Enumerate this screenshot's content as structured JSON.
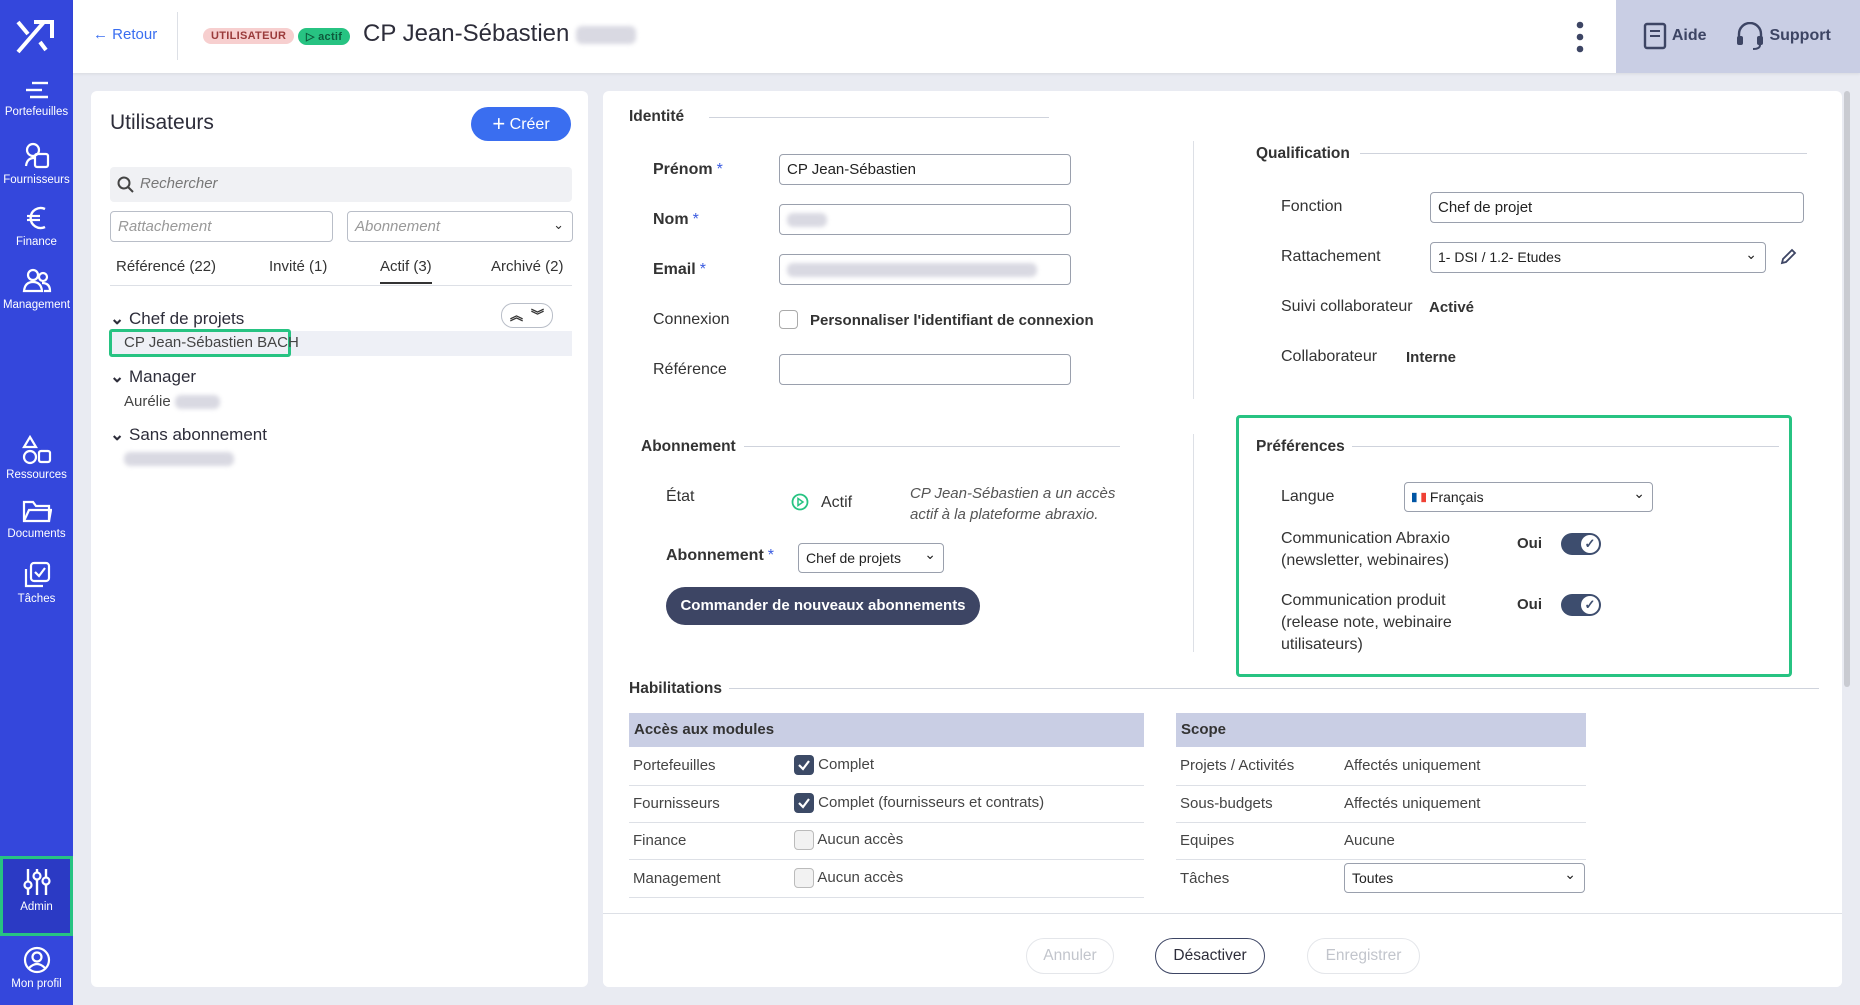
{
  "sidebar": {
    "items": [
      {
        "label": "Portefeuilles",
        "icon": "portfolio-icon"
      },
      {
        "label": "Fournisseurs",
        "icon": "suppliers-icon"
      },
      {
        "label": "Finance",
        "icon": "euro-icon"
      },
      {
        "label": "Management",
        "icon": "people-icon"
      },
      {
        "label": "Ressources",
        "icon": "shapes-icon"
      },
      {
        "label": "Documents",
        "icon": "folder-icon"
      },
      {
        "label": "Tâches",
        "icon": "tasks-icon"
      },
      {
        "label": "Admin",
        "icon": "sliders-icon"
      },
      {
        "label": "Mon profil",
        "icon": "user-circle-icon"
      }
    ]
  },
  "header": {
    "back_label": "Retour",
    "tag_user": "UTILISATEUR",
    "tag_active": "actif",
    "title": "CP Jean-Sébastien",
    "help_label": "Aide",
    "support_label": "Support"
  },
  "users": {
    "title": "Utilisateurs",
    "create_label": "Créer",
    "search_placeholder": "Rechercher",
    "rattachement_placeholder": "Rattachement",
    "abonnement_placeholder": "Abonnement",
    "tabs": [
      "Référencé (22)",
      "Invité (1)",
      "Actif (3)",
      "Archivé (2)"
    ],
    "groups": [
      {
        "name": "Chef de projets",
        "members": [
          "CP Jean-Sébastien BACH"
        ]
      },
      {
        "name": "Manager",
        "members": [
          "Aurélie"
        ]
      },
      {
        "name": "Sans abonnement",
        "members": []
      }
    ]
  },
  "identity": {
    "section": "Identité",
    "prenom_label": "Prénom",
    "prenom_value": "CP Jean-Sébastien",
    "nom_label": "Nom",
    "email_label": "Email",
    "connexion_label": "Connexion",
    "connexion_checkbox": "Personnaliser l'identifiant de connexion",
    "reference_label": "Référence",
    "required_mark": "*"
  },
  "qualification": {
    "section": "Qualification",
    "fonction_label": "Fonction",
    "fonction_value": "Chef de projet",
    "rattachement_label": "Rattachement",
    "rattachement_value": "1- DSI / 1.2- Etudes",
    "suivi_label": "Suivi collaborateur",
    "suivi_value": "Activé",
    "collaborateur_label": "Collaborateur",
    "collaborateur_value": "Interne"
  },
  "abonnement": {
    "section": "Abonnement",
    "etat_label": "État",
    "etat_value": "Actif",
    "note": "CP Jean-Sébastien a un accès actif à la plateforme abraxio.",
    "abonnement_label": "Abonnement",
    "abonnement_value": "Chef de projets",
    "order_button": "Commander de nouveaux abonnements"
  },
  "preferences": {
    "section": "Préférences",
    "langue_label": "Langue",
    "langue_value": "Français",
    "comm_abraxio_label": "Communication Abraxio (newsletter, webinaires)",
    "comm_abraxio_value": "Oui",
    "comm_produit_label": "Communication produit (release note, webinaire utilisateurs)",
    "comm_produit_value": "Oui"
  },
  "habilitations": {
    "section": "Habilitations",
    "modules_header": "Accès aux modules",
    "modules": [
      {
        "name": "Portefeuilles",
        "value": "Complet",
        "checked": true
      },
      {
        "name": "Fournisseurs",
        "value": "Complet (fournisseurs et contrats)",
        "checked": true
      },
      {
        "name": "Finance",
        "value": "Aucun accès",
        "checked": false
      },
      {
        "name": "Management",
        "value": "Aucun accès",
        "checked": false
      }
    ],
    "scope_header": "Scope",
    "scope": [
      {
        "name": "Projets / Activités",
        "value": "Affectés uniquement"
      },
      {
        "name": "Sous-budgets",
        "value": "Affectés uniquement"
      },
      {
        "name": "Equipes",
        "value": "Aucune"
      },
      {
        "name": "Tâches",
        "value": "Toutes"
      }
    ]
  },
  "footer": {
    "cancel_label": "Annuler",
    "deactivate_label": "Désactiver",
    "save_label": "Enregistrer"
  },
  "colors": {
    "sidebar": "#3447dc",
    "accent": "#3a6ef0",
    "highlight": "#27c382",
    "dark_button": "#3d4564"
  }
}
